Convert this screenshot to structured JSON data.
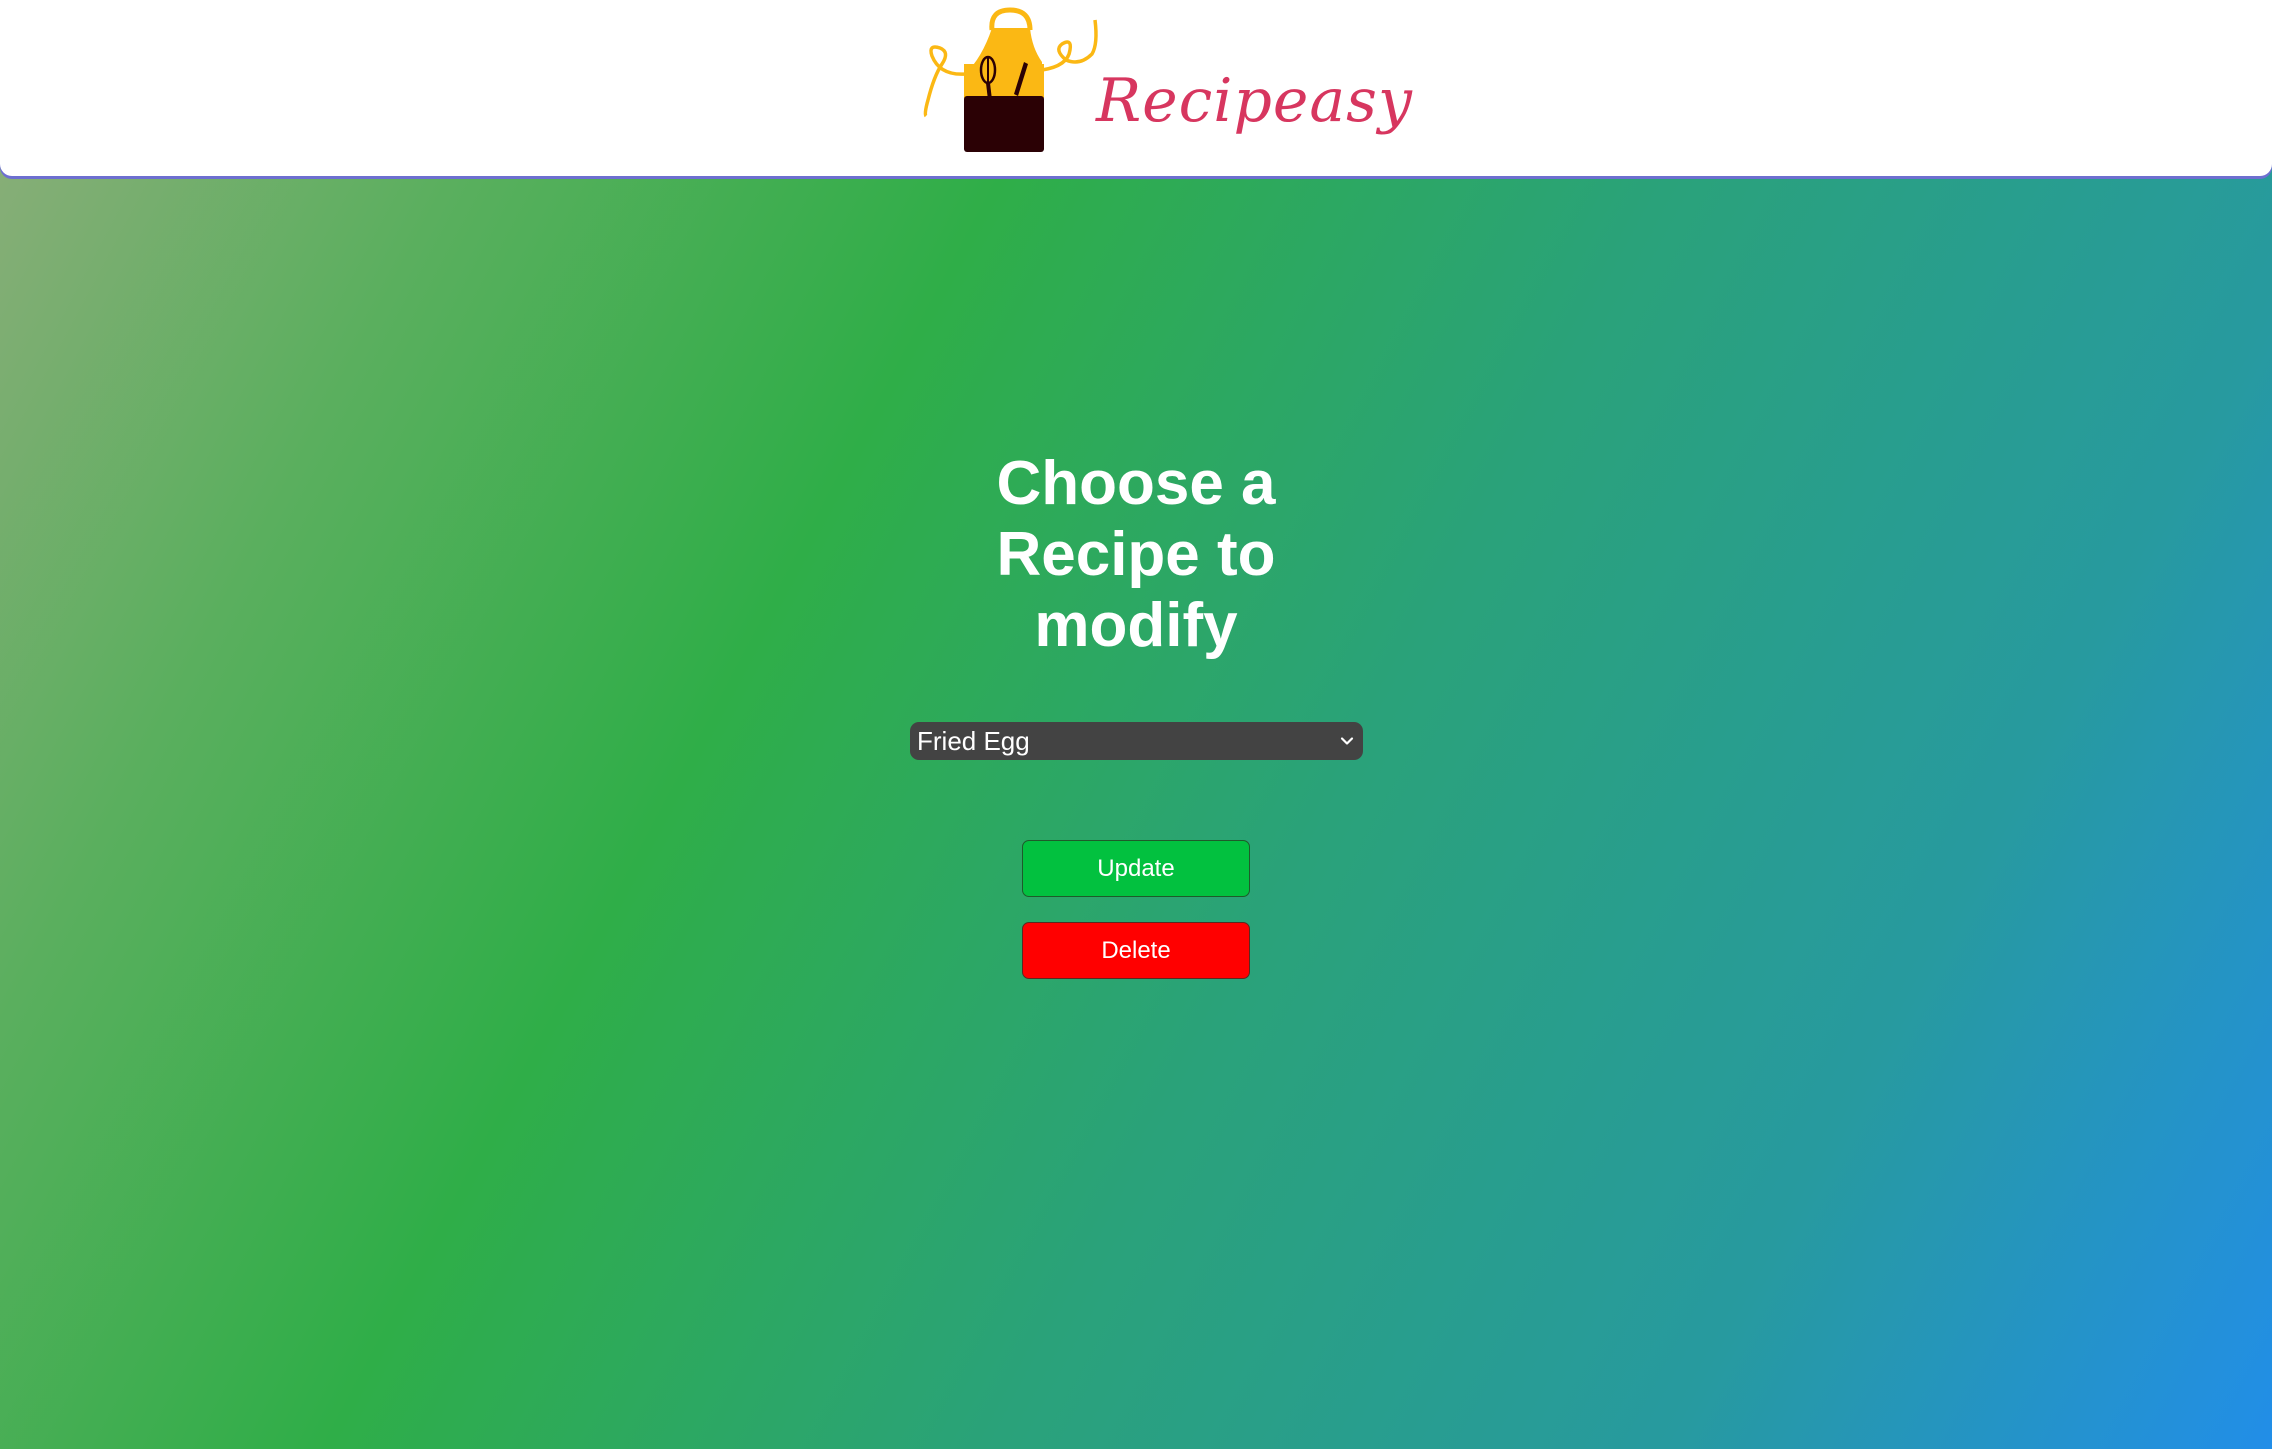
{
  "header": {
    "brand_name": "Recipeasy",
    "logo_icon": "apron-whisk-knife-icon"
  },
  "main": {
    "title": "Choose a Recipe to modify",
    "recipe_select": {
      "selected_value": "Fried Egg",
      "icon": "chevron-down-icon"
    },
    "buttons": {
      "update_label": "Update",
      "delete_label": "Delete"
    }
  },
  "colors": {
    "brand_text": "#d7365f",
    "update_button": "#02c13f",
    "delete_button": "#ff0000",
    "select_background": "#434343",
    "apron_yellow": "#fbb814",
    "pocket_dark": "#2b0105"
  }
}
